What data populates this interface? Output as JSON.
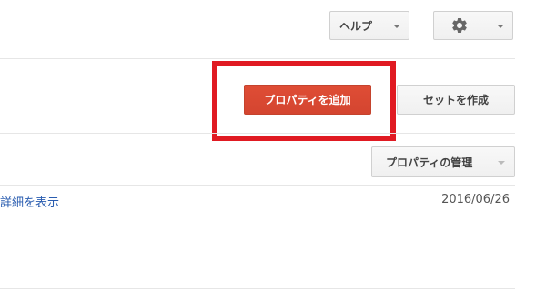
{
  "header": {
    "help_label": "ヘルプ",
    "settings_icon": "gear-icon"
  },
  "toolbar": {
    "add_property_label": "プロパティを追加",
    "create_set_label": "セットを作成"
  },
  "properties": {
    "manage_label": "プロパティの管理"
  },
  "row": {
    "details_link": "詳細を表示",
    "date": "2016/06/26"
  },
  "colors": {
    "primary_button": "#d44530",
    "highlight": "#e01a22",
    "link": "#2a5db0"
  }
}
